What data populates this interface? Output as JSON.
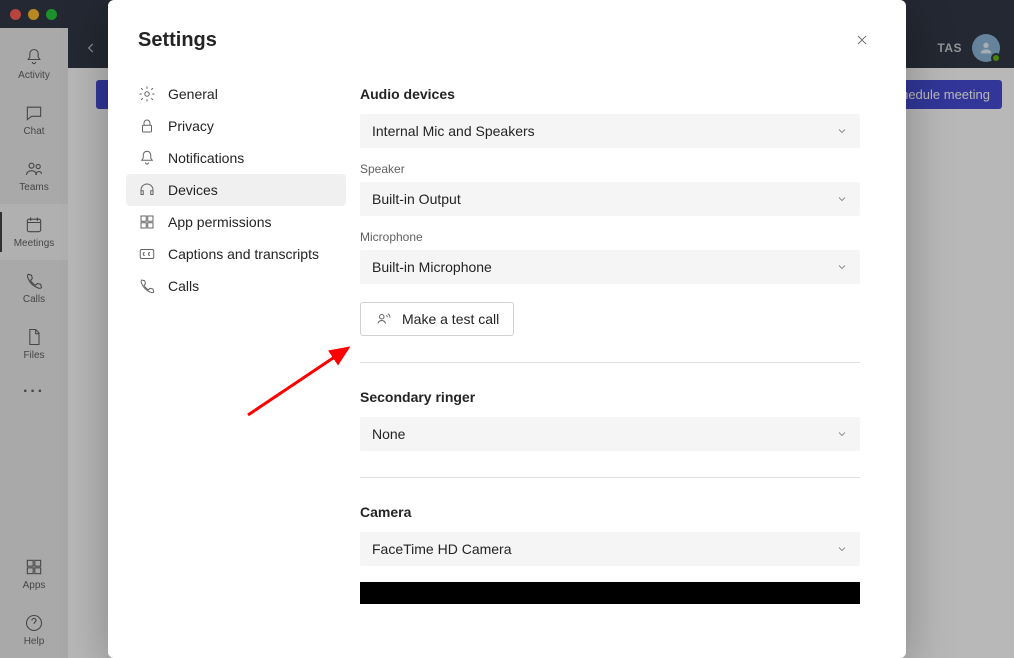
{
  "header": {
    "user_initials": "TAS"
  },
  "rail": {
    "items": [
      {
        "label": "Activity"
      },
      {
        "label": "Chat"
      },
      {
        "label": "Teams"
      },
      {
        "label": "Meetings"
      },
      {
        "label": "Calls"
      },
      {
        "label": "Files"
      }
    ],
    "bottom": [
      {
        "label": "Apps"
      },
      {
        "label": "Help"
      }
    ]
  },
  "meet_bar": {
    "schedule_label": "Schedule meeting"
  },
  "modal": {
    "title": "Settings",
    "nav": [
      {
        "label": "General"
      },
      {
        "label": "Privacy"
      },
      {
        "label": "Notifications"
      },
      {
        "label": "Devices"
      },
      {
        "label": "App permissions"
      },
      {
        "label": "Captions and transcripts"
      },
      {
        "label": "Calls"
      }
    ],
    "pane": {
      "audio_devices_title": "Audio devices",
      "audio_devices_value": "Internal Mic and Speakers",
      "speaker_label": "Speaker",
      "speaker_value": "Built-in Output",
      "mic_label": "Microphone",
      "mic_value": "Built-in Microphone",
      "test_call_label": "Make a test call",
      "secondary_title": "Secondary ringer",
      "secondary_value": "None",
      "camera_title": "Camera",
      "camera_value": "FaceTime HD Camera"
    }
  }
}
